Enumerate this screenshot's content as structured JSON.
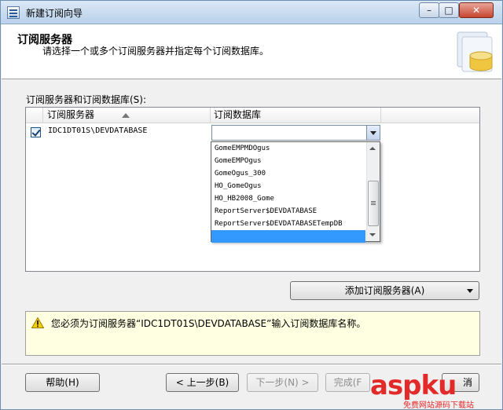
{
  "window": {
    "title": "新建订阅向导"
  },
  "header": {
    "title": "订阅服务器",
    "subtitle": "请选择一个或多个订阅服务器并指定每个订阅数据库。"
  },
  "section_label": "订阅服务器和订阅数据库(S):",
  "grid": {
    "columns": [
      "订阅服务器",
      "订阅数据库"
    ],
    "rows": [
      {
        "checked": true,
        "server": "IDC1DT01S\\DEVDATABASE",
        "database": ""
      }
    ]
  },
  "dropdown": {
    "options": [
      "GomeEMPMDOgus",
      "GomeEMPOgus",
      "GomeOgus_300",
      "HO_GomeOgus",
      "HO_HB2008_Gome",
      "ReportServer$DEVDATABASE",
      "ReportServer$DEVDATABASETempDB",
      ""
    ],
    "selected_index": 7
  },
  "add_button": {
    "label": "添加订阅服务器(A)"
  },
  "warning": {
    "text": "您必须为订阅服务器“IDC1DT01S\\DEVDATABASE”输入订阅数据库名称。"
  },
  "buttons": {
    "help": "帮助(H)",
    "back": "< 上一步(B)",
    "next": "下一步(N) >",
    "finish": "完成(F",
    "cancel": "消"
  },
  "watermark": {
    "main": "aspku",
    "sub": "免费网站源码下载站"
  },
  "colors": {
    "accent": "#3399ff",
    "warning_bg": "#ffffe1",
    "watermark": "#e32a2a"
  }
}
